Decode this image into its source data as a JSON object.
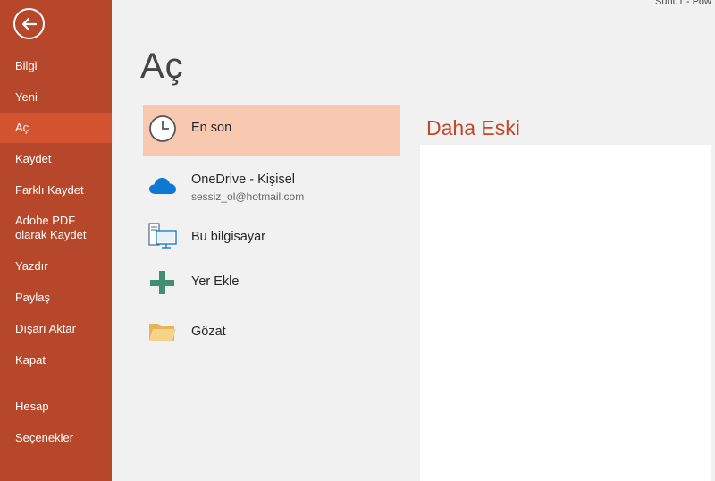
{
  "window": {
    "title_fragment": "Sunu1 - Pow"
  },
  "sidebar": {
    "items": [
      {
        "label": "Bilgi"
      },
      {
        "label": "Yeni"
      },
      {
        "label": "Aç"
      },
      {
        "label": "Kaydet"
      },
      {
        "label": "Farklı Kaydet"
      },
      {
        "label": "Adobe PDF olarak Kaydet"
      },
      {
        "label": "Yazdır"
      },
      {
        "label": "Paylaş"
      },
      {
        "label": "Dışarı Aktar"
      },
      {
        "label": "Kapat"
      },
      {
        "label": "Hesap"
      },
      {
        "label": "Seçenekler"
      }
    ],
    "active": "Aç"
  },
  "main": {
    "title": "Aç",
    "places": [
      {
        "name": "En son",
        "icon": "clock-icon",
        "selected": true
      },
      {
        "name": "OneDrive - Kişisel",
        "sub": "sessiz_ol@hotmail.com",
        "icon": "onedrive-cloud-icon"
      },
      {
        "name": "Bu bilgisayar",
        "icon": "computer-icon"
      },
      {
        "name": "Yer Ekle",
        "icon": "add-place-icon"
      },
      {
        "name": "Gözat",
        "icon": "folder-icon"
      }
    ],
    "recent_section_title": "Daha Eski"
  },
  "colors": {
    "sidebar_bg": "#b7472a",
    "sidebar_active": "#d35230",
    "selected_place_bg": "#f9c8b0",
    "accent_text": "#c4472a"
  }
}
